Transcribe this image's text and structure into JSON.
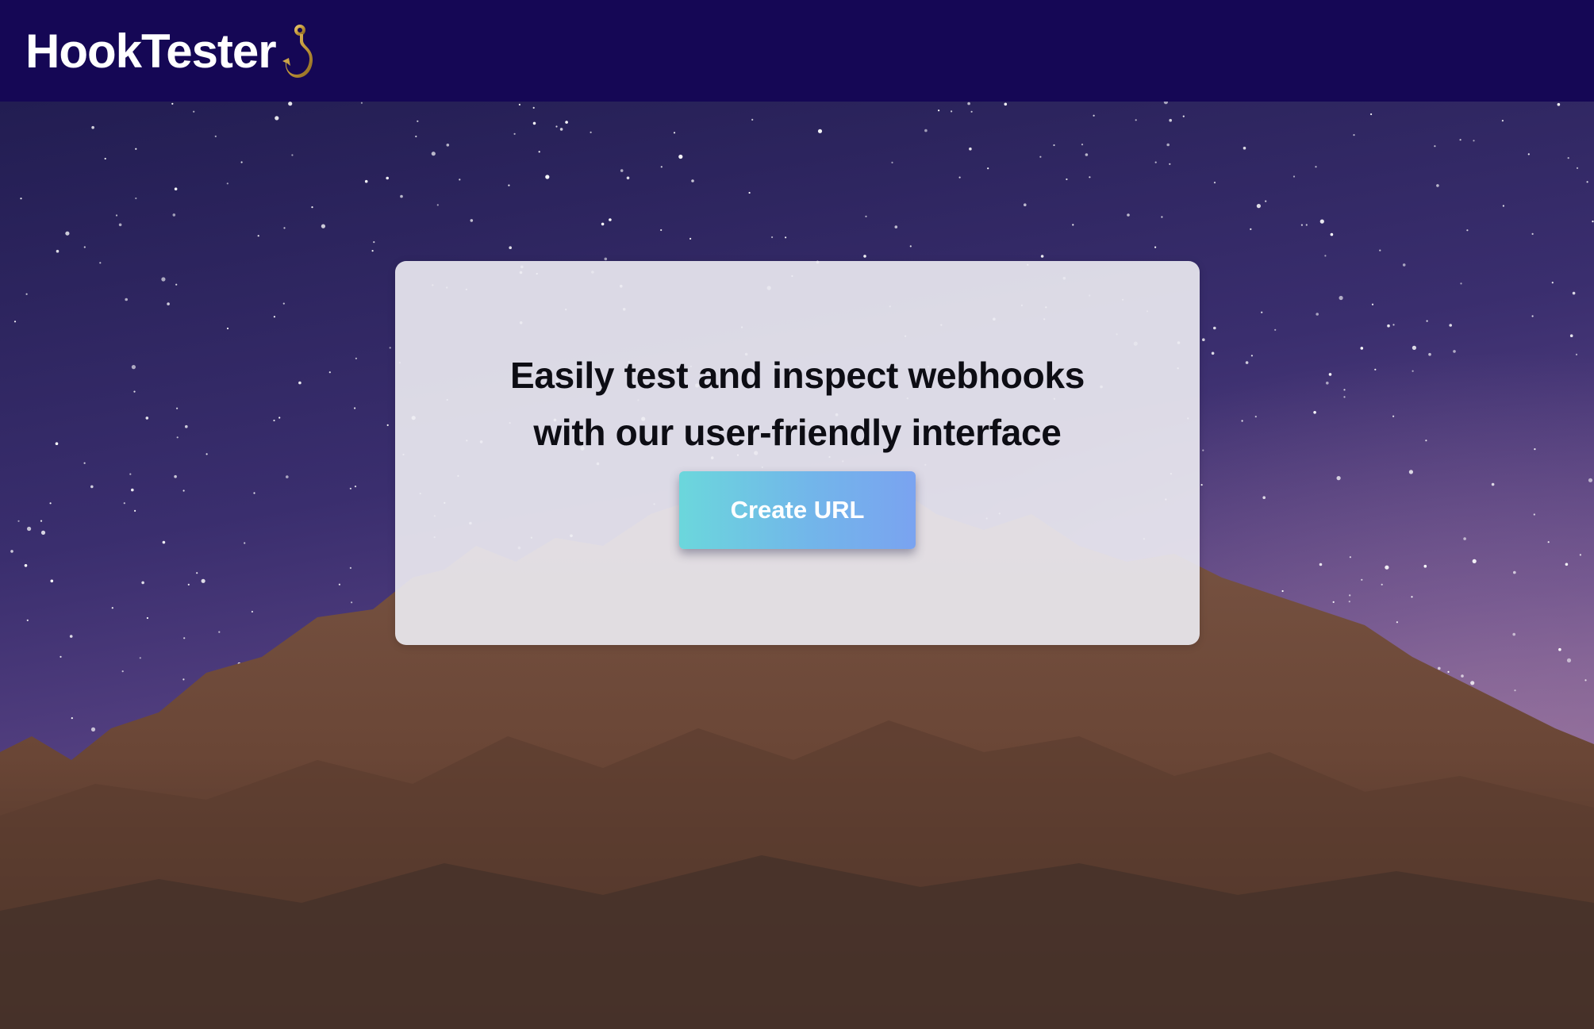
{
  "header": {
    "brand_name": "HookTester",
    "brand_icon": "hook-icon"
  },
  "hero": {
    "background": "starry-night-mountain",
    "card": {
      "headline_line1": "Easily test and inspect webhooks",
      "headline_line2": "with our user-friendly interface",
      "create_button_label": "Create URL"
    }
  },
  "colors": {
    "header_bg": "#150755",
    "brand_text": "#ffffff",
    "hook_gold": "#c49a3c",
    "button_gradient_start": "#6bd7dc",
    "button_gradient_end": "#7aa3f0",
    "sky_top": "#231c50",
    "sky_bottom": "#7a5a9a",
    "mountain": "#6e4a3a"
  }
}
